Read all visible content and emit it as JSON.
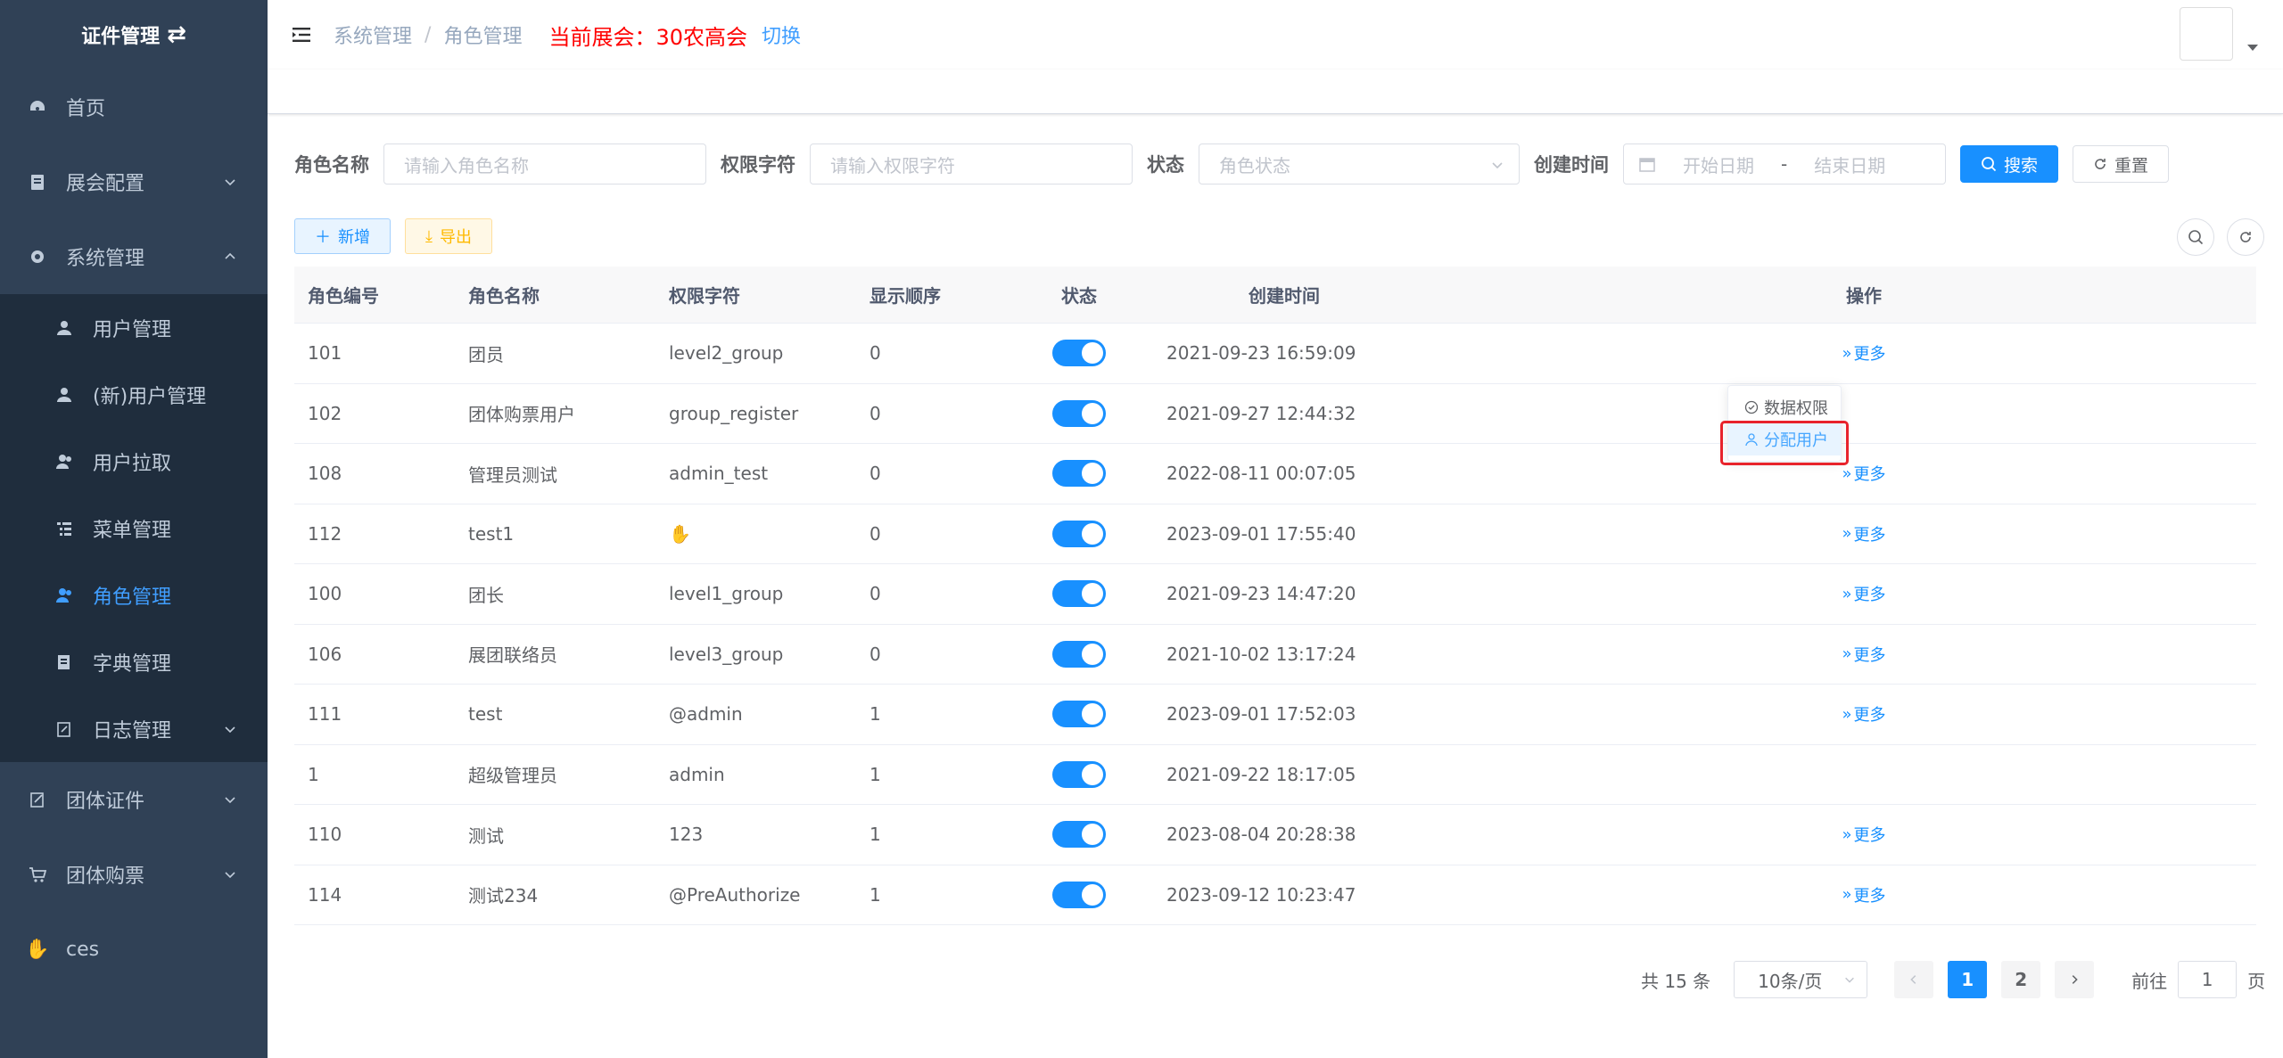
{
  "sidebar": {
    "title": "证件管理",
    "items": [
      {
        "label": "首页"
      },
      {
        "label": "展会配置"
      },
      {
        "label": "系统管理"
      }
    ],
    "sub_items": [
      {
        "label": "用户管理"
      },
      {
        "label": "(新)用户管理"
      },
      {
        "label": "用户拉取"
      },
      {
        "label": "菜单管理"
      },
      {
        "label": "角色管理"
      },
      {
        "label": "字典管理"
      },
      {
        "label": "日志管理"
      }
    ],
    "bottom_items": [
      {
        "label": "团体证件"
      },
      {
        "label": "团体购票"
      },
      {
        "label": "ces"
      }
    ]
  },
  "header": {
    "breadcrumb": [
      "系统管理",
      "/",
      "角色管理"
    ],
    "current_exhibit_label": "当前展会：",
    "current_exhibit": "30农高会",
    "switch_label": "切换"
  },
  "search": {
    "role_name_label": "角色名称",
    "role_name_placeholder": "请输入角色名称",
    "perm_label": "权限字符",
    "perm_placeholder": "请输入权限字符",
    "status_label": "状态",
    "status_placeholder": "角色状态",
    "created_label": "创建时间",
    "start_placeholder": "开始日期",
    "range_sep": "-",
    "end_placeholder": "结束日期",
    "search_btn": "搜索",
    "reset_btn": "重置"
  },
  "toolbar": {
    "add_btn": "新增",
    "export_btn": "导出"
  },
  "table": {
    "headers": [
      "角色编号",
      "角色名称",
      "权限字符",
      "显示顺序",
      "状态",
      "创建时间",
      "操作"
    ],
    "more_label": "更多",
    "rows": [
      {
        "id": "101",
        "name": "团员",
        "key": "level2_group",
        "order": "0",
        "time": "2021-09-23 16:59:09",
        "more": true
      },
      {
        "id": "102",
        "name": "团体购票用户",
        "key": "group_register",
        "order": "0",
        "time": "2021-09-27 12:44:32",
        "more": false
      },
      {
        "id": "108",
        "name": "管理员测试",
        "key": "admin_test",
        "order": "0",
        "time": "2022-08-11 00:07:05",
        "more": true
      },
      {
        "id": "112",
        "name": "test1",
        "key": "✋",
        "order": "0",
        "time": "2023-09-01 17:55:40",
        "more": true
      },
      {
        "id": "100",
        "name": "团长",
        "key": "level1_group",
        "order": "0",
        "time": "2021-09-23 14:47:20",
        "more": true
      },
      {
        "id": "106",
        "name": "展团联络员",
        "key": "level3_group",
        "order": "0",
        "time": "2021-10-02 13:17:24",
        "more": true
      },
      {
        "id": "111",
        "name": "test",
        "key": "@admin",
        "order": "1",
        "time": "2023-09-01 17:52:03",
        "more": true
      },
      {
        "id": "1",
        "name": "超级管理员",
        "key": "admin",
        "order": "1",
        "time": "2021-09-22 18:17:05",
        "more": false
      },
      {
        "id": "110",
        "name": "测试",
        "key": "123",
        "order": "1",
        "time": "2023-08-04 20:28:38",
        "more": true
      },
      {
        "id": "114",
        "name": "测试234",
        "key": "@PreAuthorize",
        "order": "1",
        "time": "2023-09-12 10:23:47",
        "more": true
      }
    ]
  },
  "dropdown": {
    "items": [
      "数据权限",
      "分配用户"
    ]
  },
  "pagination": {
    "total_text": "共 15 条",
    "page_size": "10条/页",
    "pages": [
      "1",
      "2"
    ],
    "goto_label": "前往",
    "goto_value": "1",
    "page_suffix": "页"
  },
  "colors": {
    "sidebar_bg": "#304156",
    "submenu_bg": "#1f2d3d",
    "primary": "#1890ff",
    "exhibit_red": "#ff0000",
    "highlight_box": "#e8232b"
  }
}
